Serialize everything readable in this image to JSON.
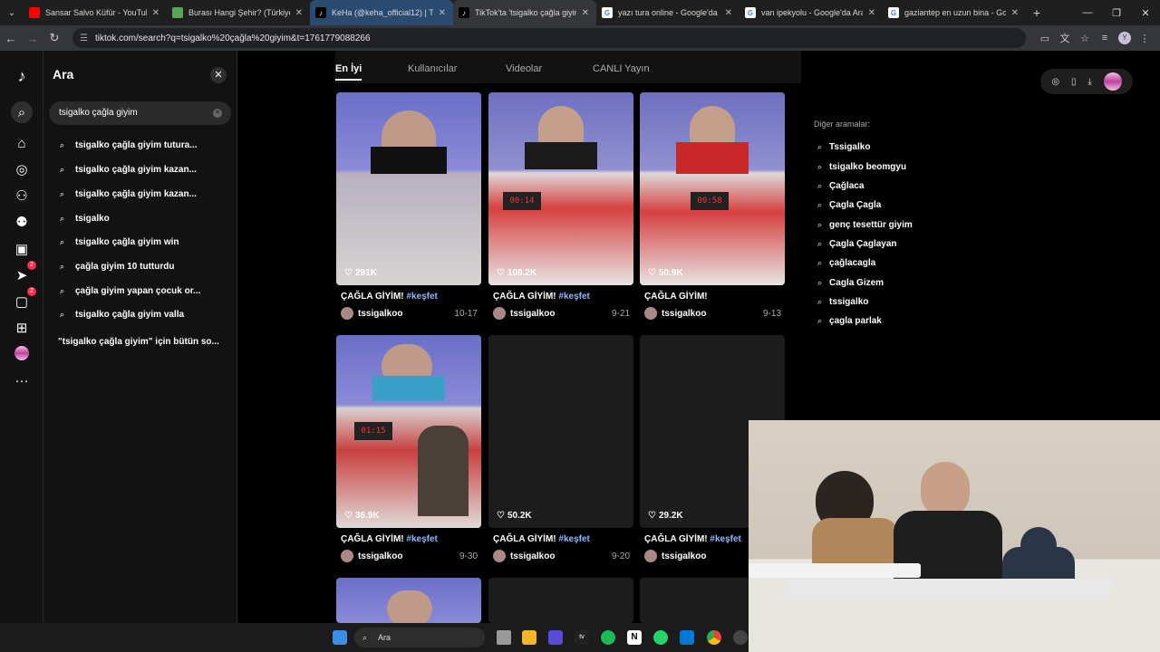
{
  "browser": {
    "tabs": [
      {
        "title": "Sansar Salvo Küfür - YouTube",
        "icon": "youtube-icon",
        "color": "#ff0000"
      },
      {
        "title": "Burası Hangi Şehir? (Türkiye) - ",
        "icon": "map-game-icon",
        "color": "#5aa55a"
      },
      {
        "title": "KeHa (@keha_official12) | Ti",
        "icon": "tiktok-icon",
        "color": "#000000"
      },
      {
        "title": "TikTok'ta 'tsigalko çağla giyim'",
        "icon": "tiktok-icon",
        "color": "#000000"
      },
      {
        "title": "yazı tura online - Google'da Ara",
        "icon": "google-icon",
        "color": "#ffffff"
      },
      {
        "title": "van ipekyolu - Google'da Ara",
        "icon": "google-icon",
        "color": "#ffffff"
      },
      {
        "title": "gaziantep en uzun bina - Goog",
        "icon": "google-icon",
        "color": "#ffffff"
      }
    ],
    "url": "tiktok.com/search?q=tsigalko%20çağla%20giyim&t=1761779088266",
    "profile_initial": "Y"
  },
  "search_panel": {
    "title": "Ara",
    "query": "tsigalko çağla giyim",
    "suggestions": [
      "tsigalko çağla giyim tutura...",
      "tsigalko çağla giyim kazan...",
      "tsigalko çağla giyim kazan...",
      "tsigalko",
      "tsigalko çağla giyim win",
      "çağla giyim 10 tutturdu",
      "çağla giyim yapan çocuk or...",
      "tsigalko çağla giyim valla"
    ],
    "all_results": "\"tsigalko çağla giyim\" için bütün so..."
  },
  "rail": {
    "badges": [
      "2",
      "2"
    ]
  },
  "tabs": [
    "En İyi",
    "Kullanıcılar",
    "Videolar",
    "CANLI Yayın"
  ],
  "videos": [
    {
      "likes": "291K",
      "title": "ÇAĞLA GİYİM!",
      "tag": "#keşfet",
      "user": "tssigalkoo",
      "date": "10-17"
    },
    {
      "likes": "108.2K",
      "title": "ÇAĞLA GİYİM!",
      "tag": "#keşfet",
      "user": "tssigalkoo",
      "date": "9-21"
    },
    {
      "likes": "50.9K",
      "title": "ÇAĞLA GİYİM!",
      "tag": "",
      "user": "tssigalkoo",
      "date": "9-13"
    },
    {
      "likes": "36.9K",
      "title": "ÇAĞLA GİYİM!",
      "tag": "#keşfet",
      "user": "tssigalkoo",
      "date": "9-30"
    },
    {
      "likes": "50.2K",
      "title": "ÇAĞLA GİYİM!",
      "tag": "#keşfet",
      "user": "tssigalkoo",
      "date": "9-20"
    },
    {
      "likes": "29.2K",
      "title": "ÇAĞLA GİYİM!",
      "tag": "#keşfet",
      "user": "tssigalkoo",
      "date": ""
    }
  ],
  "other_searches": {
    "title": "Diğer aramalar:",
    "items": [
      "Tssigalko",
      "tsigalko beomgyu",
      "Çağlaca",
      "Çagla Çagla",
      "genç tesettür giyim",
      "Çagla Çaglayan",
      "çağlacagla",
      "Cagla Gizem",
      "tssigalko",
      "çagla parlak"
    ]
  },
  "taskbar": {
    "search_placeholder": "Ara"
  }
}
